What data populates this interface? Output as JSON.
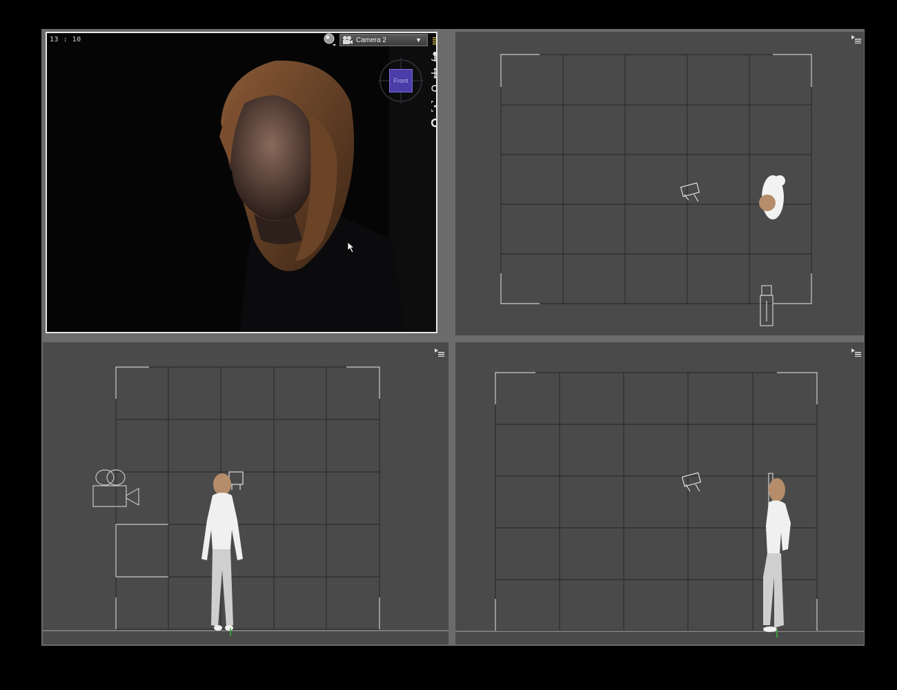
{
  "render_view": {
    "timecode": "13 : 10",
    "camera_select": {
      "selected": "Camera 2"
    },
    "cube_gizmo_label": "Front"
  },
  "panes": {
    "top_right": {
      "menu_icon": "pane-menu-icon"
    },
    "bottom_left": {
      "menu_icon": "pane-menu-icon"
    },
    "bottom_right": {
      "menu_icon": "pane-menu-icon"
    }
  },
  "colors": {
    "background": "#000000",
    "pane": "#4a4a4a",
    "grid_line": "#2c2c2c",
    "divider": "#6b6b6b",
    "render_border": "#e8e8e8",
    "cube_face": "#4b3da8"
  },
  "icons": {
    "sphere": "sphere-icon",
    "camera": "camera-icon",
    "dropdown": "chevron-down-icon",
    "nav_tools": [
      "rotate-icon",
      "move-icon",
      "zoom-icon",
      "frame-icon",
      "orbit-icon"
    ]
  }
}
